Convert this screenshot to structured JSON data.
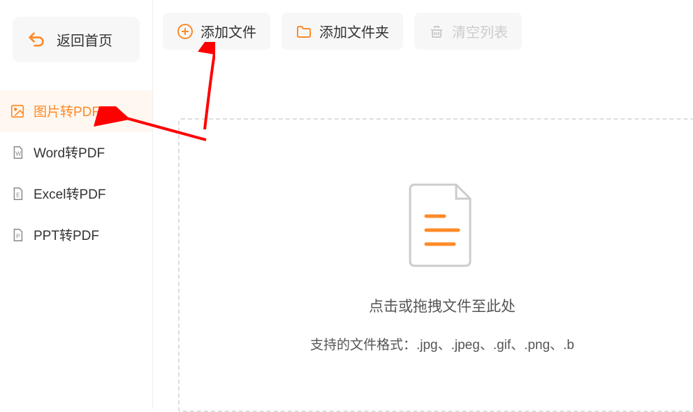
{
  "sidebar": {
    "back_label": "返回首页",
    "items": [
      {
        "label": "图片转PDF"
      },
      {
        "label": "Word转PDF"
      },
      {
        "label": "Excel转PDF"
      },
      {
        "label": "PPT转PDF"
      }
    ]
  },
  "toolbar": {
    "add_file_label": "添加文件",
    "add_folder_label": "添加文件夹",
    "clear_list_label": "清空列表"
  },
  "dropzone": {
    "hint": "点击或拖拽文件至此处",
    "formats": "支持的文件格式：.jpg、.jpeg、.gif、.png、.b"
  }
}
